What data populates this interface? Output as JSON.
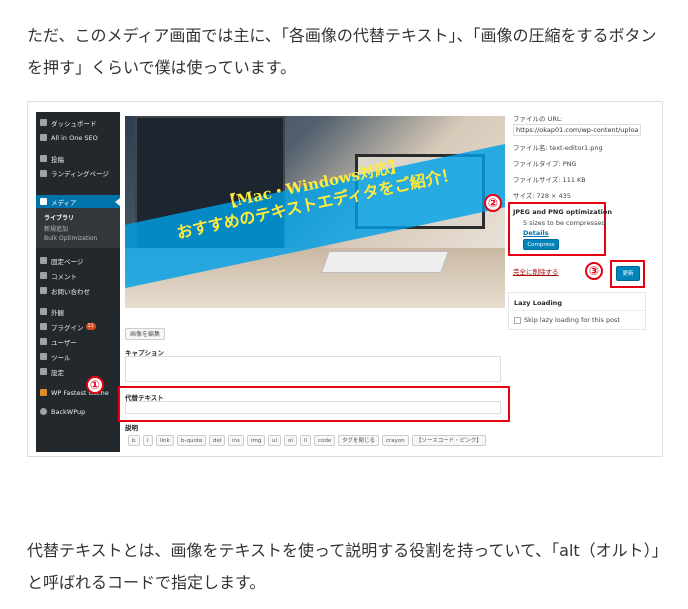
{
  "paragraph_top": "ただ、このメディア画面では主に、「各画像の代替テキスト」、「画像の圧縮をするボタンを押す」くらいで僕は使っています。",
  "paragraph_bottom": "代替テキストとは、画像をテキストを使って説明する役割を持っていて、「alt（オルト）」と呼ばれるコードで指定します。",
  "sidebar": {
    "items": [
      {
        "label": "ダッシュボード",
        "icon": "dashboard-icon"
      },
      {
        "label": "All in One SEO",
        "icon": "seo-icon"
      },
      {
        "label": "投稿",
        "icon": "pin-icon"
      },
      {
        "label": "ランディングページ",
        "icon": "page-icon"
      },
      {
        "label": "メディア",
        "icon": "media-icon"
      },
      {
        "label": "固定ページ",
        "icon": "page-icon"
      },
      {
        "label": "コメント",
        "icon": "comment-icon"
      },
      {
        "label": "お問い合わせ",
        "icon": "mail-icon"
      },
      {
        "label": "外観",
        "icon": "brush-icon"
      },
      {
        "label": "プラグイン",
        "icon": "plugin-icon",
        "badge": "11"
      },
      {
        "label": "ユーザー",
        "icon": "user-icon"
      },
      {
        "label": "ツール",
        "icon": "wrench-icon"
      },
      {
        "label": "設定",
        "icon": "settings-icon"
      },
      {
        "label": "WP Fastest Cache",
        "icon": "cache-icon"
      },
      {
        "label": "BackWPup",
        "icon": "backup-icon"
      }
    ],
    "media_sub": [
      "ライブラリ",
      "新規追加",
      "Bulk Optimization"
    ]
  },
  "hero": {
    "line1": "【Mac・Windows対応】",
    "line2": "おすすめのテキストエディタをご紹介！"
  },
  "edit_image_label": "画像を編集",
  "caption_label": "キャプション",
  "alt_label": "代替テキスト",
  "description_label": "説明",
  "quicktags": [
    "b",
    "i",
    "link",
    "b-quote",
    "del",
    "ins",
    "img",
    "ul",
    "ol",
    "li",
    "code",
    "タグを閉じる",
    "crayon",
    "【ソースコード・ピンク】"
  ],
  "file_info": {
    "url_label": "ファイルの URL:",
    "url_value": "https://okap01.com/wp-content/uploa",
    "name": "ファイル名: text-editor1.png",
    "type": "ファイルタイプ: PNG",
    "size": "ファイルサイズ: 111 KB",
    "dimensions": "サイズ: 728 × 435"
  },
  "optimization": {
    "title": "JPEG and PNG optimization",
    "status": "5 sizes to be compressed",
    "details": "Details",
    "button": "Compress"
  },
  "delete_link": "完全に削除する",
  "update_button": "更新",
  "lazy": {
    "title": "Lazy Loading",
    "checkbox_label": "Skip lazy loading for this post"
  },
  "callouts": [
    "①",
    "②",
    "③"
  ],
  "colors": {
    "accent_red": "#e60012",
    "wp_blue": "#0073aa",
    "sidebar_bg": "#23282d"
  }
}
